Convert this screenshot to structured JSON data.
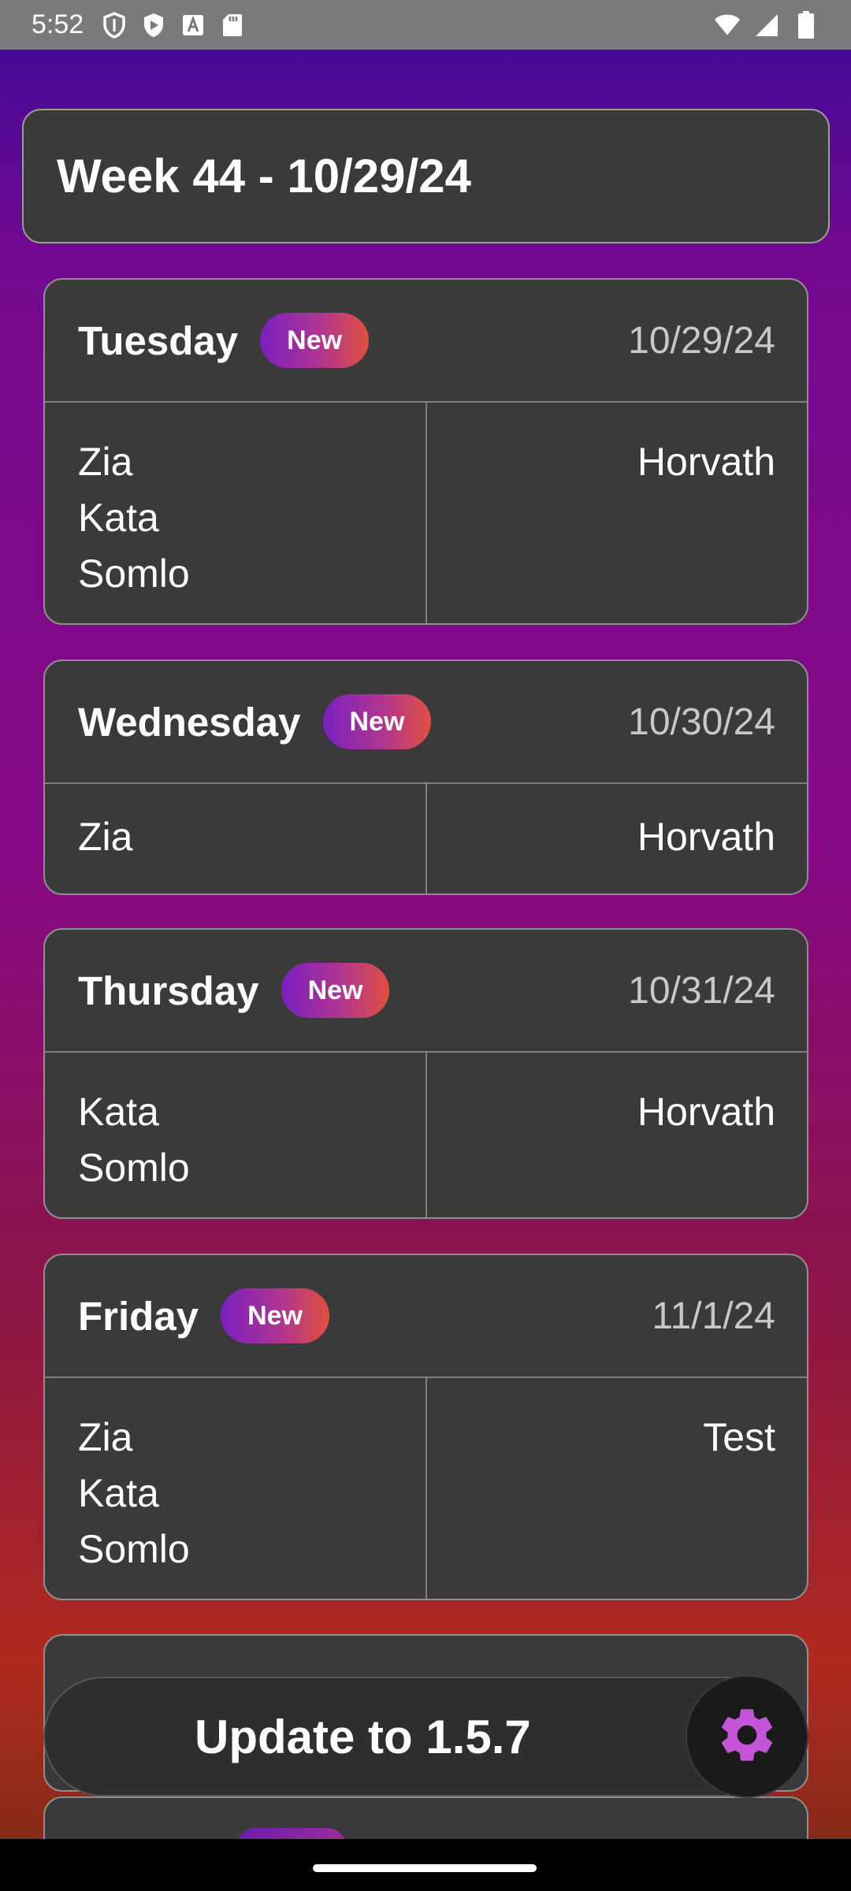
{
  "status_bar": {
    "time": "5:52",
    "icons": [
      "shield-icon",
      "play-store-icon",
      "font-icon",
      "sd-card-icon"
    ],
    "right_icons": [
      "wifi-icon",
      "signal-icon",
      "battery-icon"
    ]
  },
  "week": {
    "title": "Week 44 - 10/29/24"
  },
  "days": [
    {
      "name": "Tuesday",
      "badge": "New",
      "date": "10/29/24",
      "left": [
        "Zia",
        "Kata",
        "Somlo"
      ],
      "right": [
        "Horvath"
      ]
    },
    {
      "name": "Wednesday",
      "badge": "New",
      "date": "10/30/24",
      "left": [
        "Zia"
      ],
      "right": [
        "Horvath"
      ]
    },
    {
      "name": "Thursday",
      "badge": "New",
      "date": "10/31/24",
      "left": [
        "Kata",
        "Somlo"
      ],
      "right": [
        "Horvath"
      ]
    },
    {
      "name": "Friday",
      "badge": "New",
      "date": "11/1/24",
      "left": [
        "Zia",
        "Kata",
        "Somlo"
      ],
      "right": [
        "Test"
      ]
    }
  ],
  "update": {
    "label": "Update to 1.5.7"
  },
  "settings": {
    "icon": "gear-icon",
    "color": "#c455d8"
  },
  "colors": {
    "card_bg": "#3a3a3a",
    "badge_gradient": [
      "#7a1fc0",
      "#e0503e"
    ],
    "background_gradient": [
      "#3a0b99",
      "#860a86",
      "#b02a1d"
    ]
  }
}
